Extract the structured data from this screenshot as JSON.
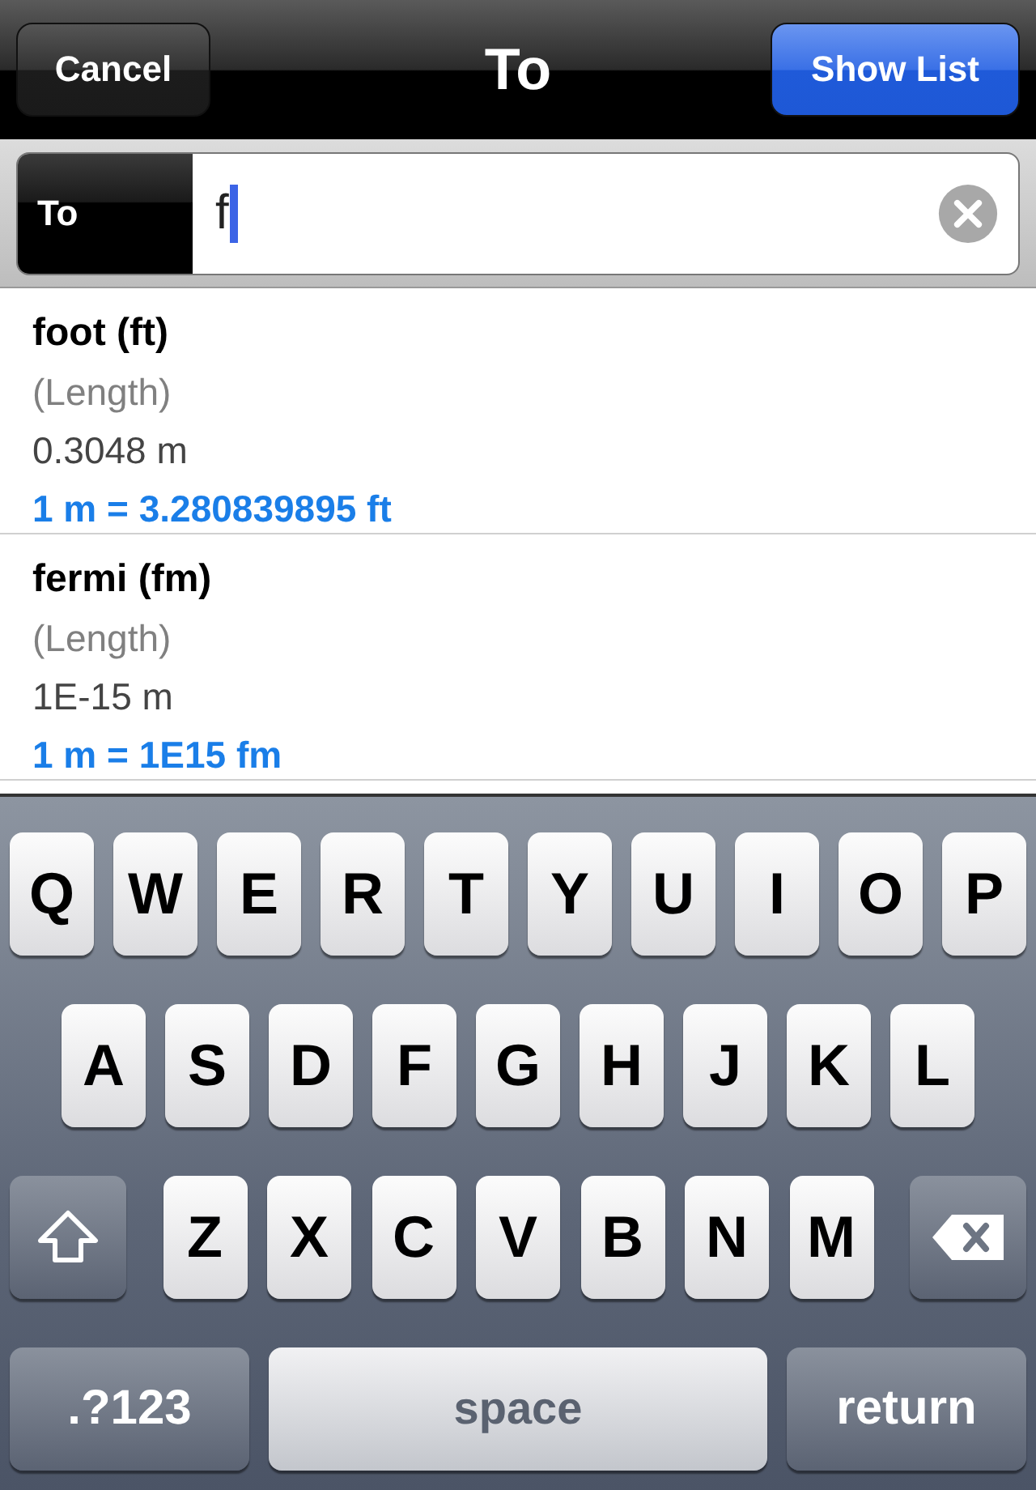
{
  "nav_bar": {
    "cancel": "Cancel",
    "title": "To",
    "show_list": "Show List"
  },
  "search": {
    "label": "To",
    "value": "f"
  },
  "results": [
    {
      "name": "foot (ft)",
      "category": "(Length)",
      "value": "0.3048 m",
      "conversion": "1 m = 3.280839895 ft"
    },
    {
      "name": "fermi (fm)",
      "category": "(Length)",
      "value": "1E-15 m",
      "conversion": "1 m = 1E15 fm"
    }
  ],
  "keyboard": {
    "rows": [
      [
        {
          "kind": "letter",
          "label": "Q"
        },
        {
          "kind": "letter",
          "label": "W"
        },
        {
          "kind": "letter",
          "label": "E"
        },
        {
          "kind": "letter",
          "label": "R"
        },
        {
          "kind": "letter",
          "label": "T"
        },
        {
          "kind": "letter",
          "label": "Y"
        },
        {
          "kind": "letter",
          "label": "U"
        },
        {
          "kind": "letter",
          "label": "I"
        },
        {
          "kind": "letter",
          "label": "O"
        },
        {
          "kind": "letter",
          "label": "P"
        }
      ],
      [
        {
          "kind": "letter",
          "label": "A"
        },
        {
          "kind": "letter",
          "label": "S"
        },
        {
          "kind": "letter",
          "label": "D"
        },
        {
          "kind": "letter",
          "label": "F"
        },
        {
          "kind": "letter",
          "label": "G"
        },
        {
          "kind": "letter",
          "label": "H"
        },
        {
          "kind": "letter",
          "label": "J"
        },
        {
          "kind": "letter",
          "label": "K"
        },
        {
          "kind": "letter",
          "label": "L"
        }
      ],
      [
        {
          "kind": "shift"
        },
        {
          "kind": "letter",
          "label": "Z"
        },
        {
          "kind": "letter",
          "label": "X"
        },
        {
          "kind": "letter",
          "label": "C"
        },
        {
          "kind": "letter",
          "label": "V"
        },
        {
          "kind": "letter",
          "label": "B"
        },
        {
          "kind": "letter",
          "label": "N"
        },
        {
          "kind": "letter",
          "label": "M"
        },
        {
          "kind": "delete"
        }
      ]
    ],
    "bottom_row": {
      "mode_key": ".?123",
      "space_key": "space",
      "return_key": "return"
    }
  }
}
